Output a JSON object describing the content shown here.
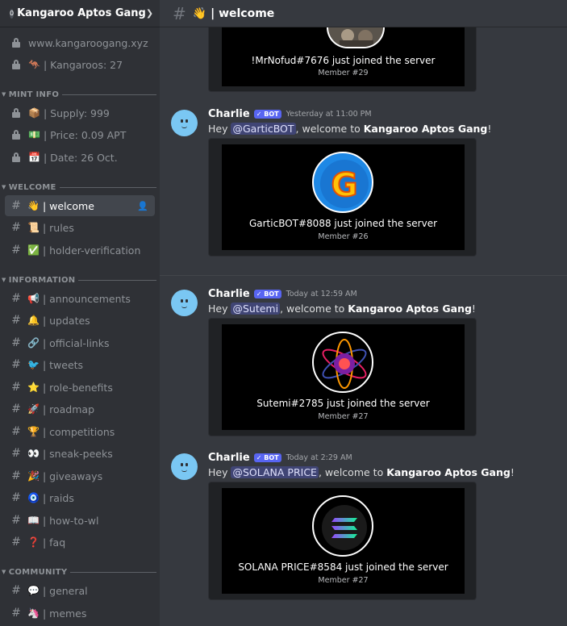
{
  "server": {
    "name": "Kangaroo Aptos Gang",
    "badge": "0"
  },
  "header": {
    "channel": "| welcome",
    "emoji": "👋"
  },
  "sidebar": {
    "top": [
      {
        "emoji": "",
        "label": "www.kangaroogang.xyz"
      },
      {
        "emoji": "🦘",
        "label": "| Kangaroos: 27"
      }
    ],
    "mint_info": {
      "title": "MINT INFO",
      "items": [
        {
          "emoji": "📦",
          "label": "| Supply: 999"
        },
        {
          "emoji": "💵",
          "label": "| Price: 0.09 APT"
        },
        {
          "emoji": "📅",
          "label": "| Date: 26 Oct."
        }
      ]
    },
    "welcome": {
      "title": "WELCOME",
      "items": [
        {
          "emoji": "👋",
          "label": "| welcome"
        },
        {
          "emoji": "📜",
          "label": "| rules"
        },
        {
          "emoji": "✅",
          "label": "| holder-verification"
        }
      ]
    },
    "information": {
      "title": "INFORMATION",
      "items": [
        {
          "emoji": "📢",
          "label": "| announcements"
        },
        {
          "emoji": "🔔",
          "label": "| updates"
        },
        {
          "emoji": "🔗",
          "label": "| official-links"
        },
        {
          "emoji": "🐦",
          "label": "| tweets"
        },
        {
          "emoji": "⭐",
          "label": "| role-benefits"
        },
        {
          "emoji": "🚀",
          "label": "| roadmap"
        },
        {
          "emoji": "🏆",
          "label": "| competitions"
        },
        {
          "emoji": "👀",
          "label": "| sneak-peeks"
        },
        {
          "emoji": "🎉",
          "label": "| giveaways"
        },
        {
          "emoji": "🧿",
          "label": "| raids"
        },
        {
          "emoji": "📖",
          "label": "| how-to-wl"
        },
        {
          "emoji": "❓",
          "label": "| faq"
        }
      ]
    },
    "community": {
      "title": "COMMUNITY",
      "items": [
        {
          "emoji": "💬",
          "label": "| general"
        },
        {
          "emoji": "🦄",
          "label": "| memes"
        }
      ]
    }
  },
  "messages": {
    "top_card": {
      "joined": "!MrNofud#7676 just joined the server",
      "member": "Member #29"
    },
    "list": [
      {
        "author": "Charlie",
        "bot": "BOT",
        "time": "Yesterday at 11:00 PM",
        "hey": "Hey ",
        "mention": "@GarticBOT",
        "mid": ", welcome to ",
        "server": "Kangaroo Aptos Gang",
        "end": "!",
        "joined": "GarticBOT#8088 just joined the server",
        "member": "Member #26",
        "pfp": "gartic"
      },
      {
        "author": "Charlie",
        "bot": "BOT",
        "time": "Today at 12:59 AM",
        "hey": "Hey ",
        "mention": "@Sutemi",
        "mid": ", welcome to ",
        "server": "Kangaroo Aptos Gang",
        "end": "!",
        "joined": "Sutemi#2785 just joined the server",
        "member": "Member #27",
        "pfp": "sutemi"
      },
      {
        "author": "Charlie",
        "bot": "BOT",
        "time": "Today at 2:29 AM",
        "hey": "Hey ",
        "mention": "@SOLANA PRICE",
        "mid": ", welcome to ",
        "server": "Kangaroo Aptos Gang",
        "end": "!",
        "joined": "SOLANA PRICE#8584 just joined the server",
        "member": "Member #27",
        "pfp": "solana"
      }
    ]
  },
  "colors": {
    "accent": "#5865f2",
    "bg": "#36393f",
    "sidebar": "#2f3136"
  }
}
